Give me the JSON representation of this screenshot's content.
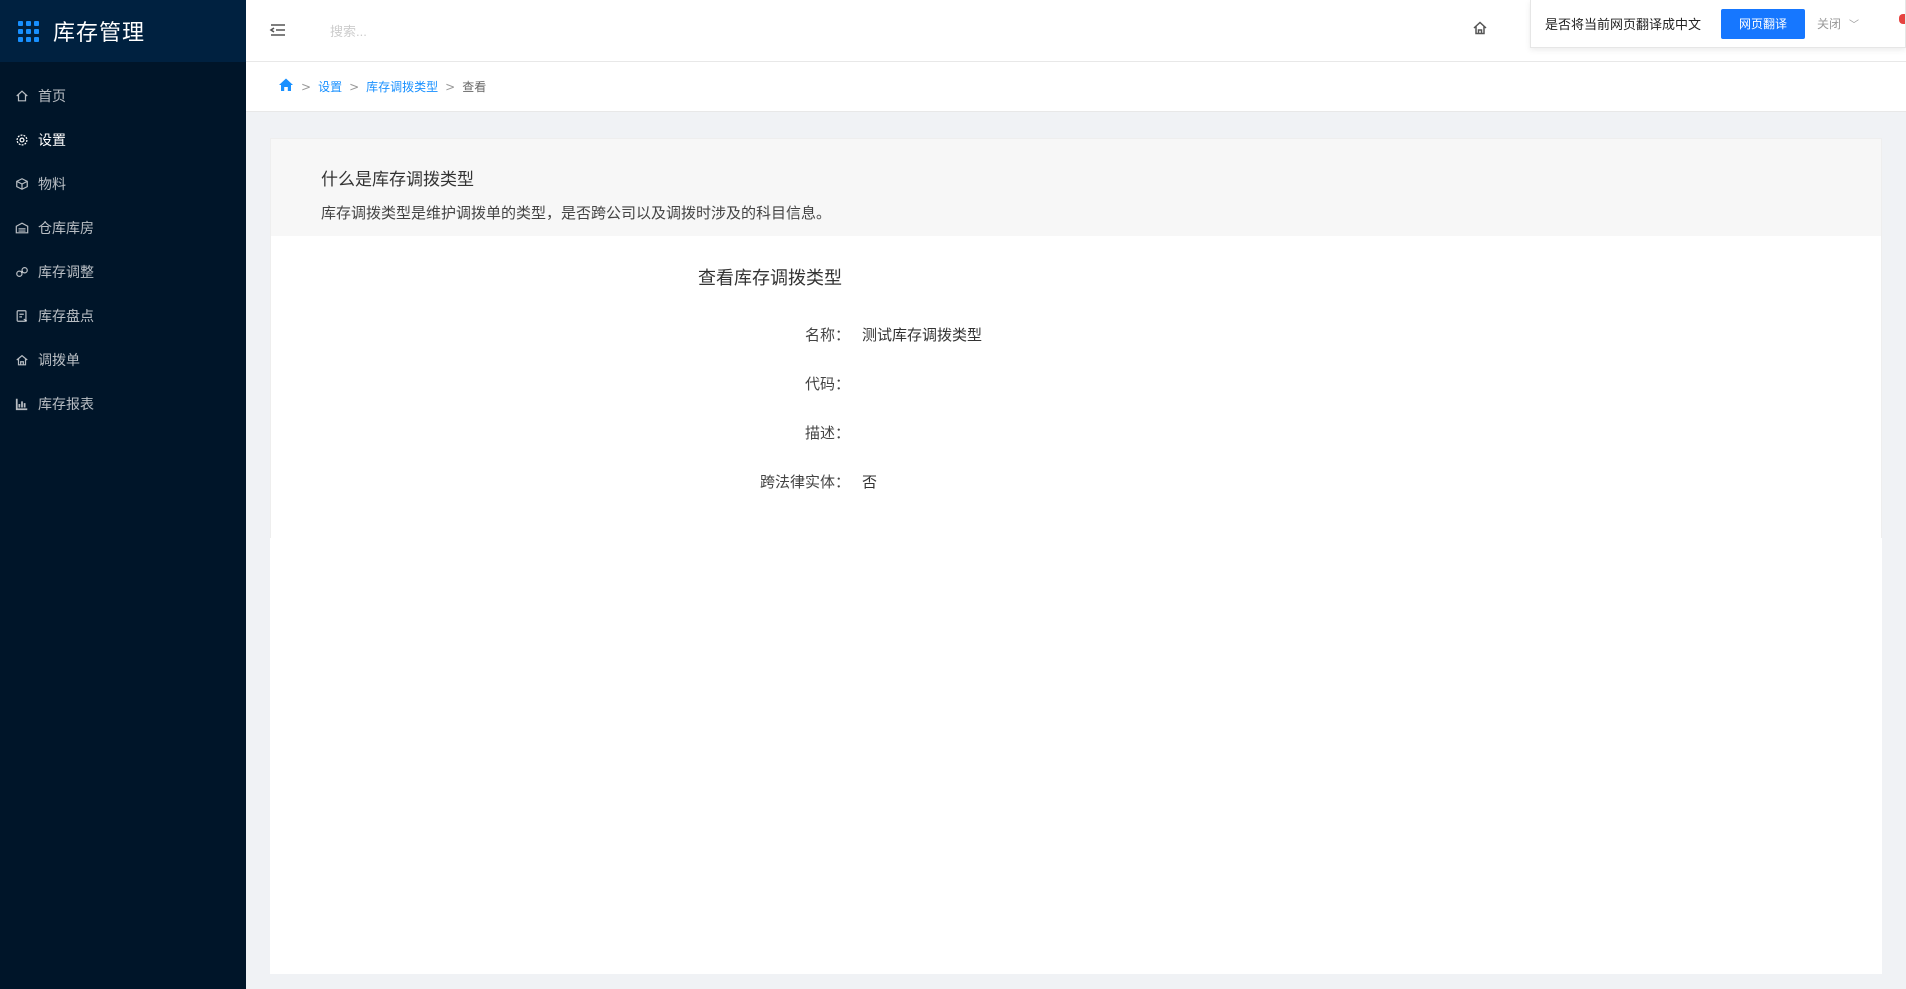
{
  "app": {
    "title": "库存管理"
  },
  "sidebar": {
    "items": [
      {
        "label": "首页",
        "icon": "home-icon"
      },
      {
        "label": "设置",
        "icon": "gear-icon"
      },
      {
        "label": "物料",
        "icon": "cube-icon"
      },
      {
        "label": "仓库库房",
        "icon": "warehouse-icon"
      },
      {
        "label": "库存调整",
        "icon": "adjust-icon"
      },
      {
        "label": "库存盘点",
        "icon": "checklist-icon"
      },
      {
        "label": "调拨单",
        "icon": "transfer-icon"
      },
      {
        "label": "库存报表",
        "icon": "bar-chart-icon"
      }
    ],
    "active_index": 1
  },
  "header": {
    "search_placeholder": "搜索...",
    "icons": [
      "menu-fold-icon",
      "home-icon"
    ]
  },
  "translate": {
    "prompt": "是否将当前网页翻译成中文",
    "button": "网页翻译",
    "close": "关闭"
  },
  "breadcrumb": {
    "items": [
      "设置",
      "库存调拨类型"
    ],
    "current": "查看"
  },
  "intro": {
    "title": "什么是库存调拨类型",
    "description": "库存调拨类型是维护调拨单的类型，是否跨公司以及调拨时涉及的科目信息。"
  },
  "form": {
    "title": "查看库存调拨类型",
    "fields": [
      {
        "label": "名称：",
        "value": "测试库存调拨类型"
      },
      {
        "label": "代码：",
        "value": ""
      },
      {
        "label": "描述：",
        "value": ""
      },
      {
        "label": "跨法律实体：",
        "value": "否"
      }
    ]
  },
  "colors": {
    "sidebar_bg": "#001529",
    "accent": "#1890ff",
    "translate_button": "#1677ff"
  }
}
